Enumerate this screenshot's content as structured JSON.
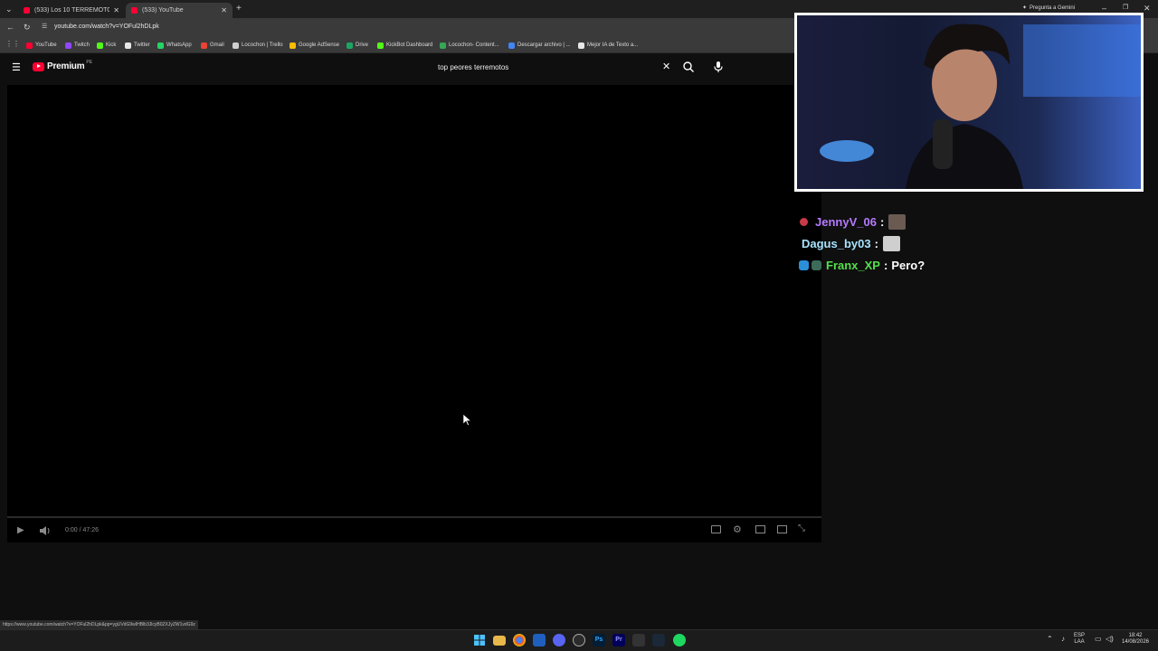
{
  "browser": {
    "tabs": [
      {
        "title": "(533) Los 10 TERREMOTOS más"
      },
      {
        "title": "(533) YouTube"
      }
    ],
    "new_tab_label": "+",
    "gemini_label": "Pregunta a Gemini",
    "url": "youtube.com/watch?v=YOFul2hDLpk",
    "bookmarks": [
      {
        "label": "YouTube",
        "color": "#ff0033"
      },
      {
        "label": "Twitch",
        "color": "#9146ff"
      },
      {
        "label": "Kick",
        "color": "#53fc18"
      },
      {
        "label": "Twitter",
        "color": "#e7e7e7"
      },
      {
        "label": "WhatsApp",
        "color": "#25d366"
      },
      {
        "label": "Gmail",
        "color": "#ea4335"
      },
      {
        "label": "Locochon | Trello",
        "color": "#cfcfcf"
      },
      {
        "label": "Google AdSense",
        "color": "#fbbc04"
      },
      {
        "label": "Drive",
        "color": "#1fa463"
      },
      {
        "label": "KickBot Dashboard",
        "color": "#53fc18"
      },
      {
        "label": "Locochon- Content...",
        "color": "#34a853"
      },
      {
        "label": "Descargar archivo | ...",
        "color": "#4285f4"
      },
      {
        "label": "Mejor IA de Texto a...",
        "color": "#e7e7e7"
      }
    ],
    "status_url": "https://www.youtube.com/watch?v=YOFul2hDLpk&pp=ygUVdG9wIHBlb3JlcyB0ZXJyZW1vdG9z"
  },
  "youtube": {
    "logo_text": "Premium",
    "region": "PE",
    "search_value": "top peores terremotos",
    "player_time": "0:00 / 47:26"
  },
  "chat": [
    {
      "user": "JennyV_06",
      "separator": ":",
      "message": "",
      "color": "#b57bff"
    },
    {
      "user": "Dagus_by03",
      "separator": ":",
      "message": "",
      "color": "#a7e3ff"
    },
    {
      "user": "Franx_XP",
      "separator": ":",
      "message": "Pero?",
      "color": "#53e04a"
    }
  ],
  "taskbar": {
    "lang_top": "ESP",
    "lang_bottom": "LAA",
    "clock_time": "18:42",
    "clock_date": "14/08/2026"
  }
}
